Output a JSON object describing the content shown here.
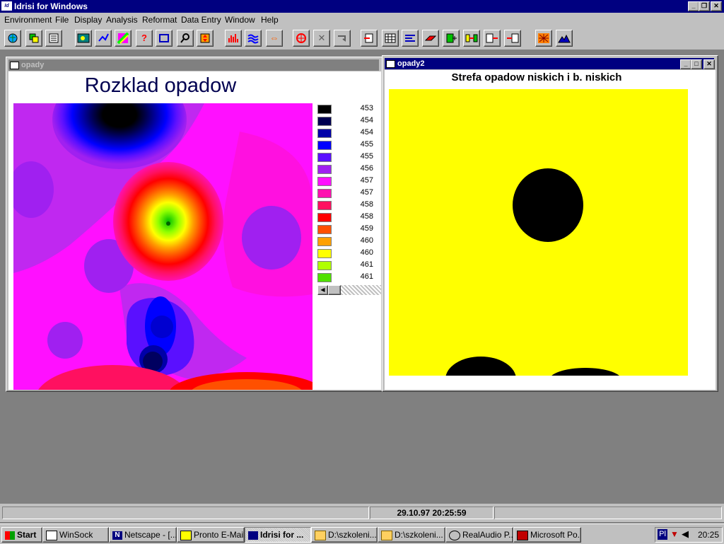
{
  "app": {
    "title": "Idrisi for Windows",
    "logo_text": "Idrisi"
  },
  "menu": [
    "Environment",
    "File",
    "Display",
    "Analysis",
    "Reformat",
    "Data Entry",
    "Window",
    "Help"
  ],
  "window1": {
    "title": "opady",
    "map_title": "Rozklad opadow",
    "legend": [
      {
        "label": "453",
        "color": "#000000"
      },
      {
        "label": "454",
        "color": "#000050"
      },
      {
        "label": "454",
        "color": "#0000a8"
      },
      {
        "label": "455",
        "color": "#0000ff"
      },
      {
        "label": "455",
        "color": "#5a10ff"
      },
      {
        "label": "456",
        "color": "#a020f0"
      },
      {
        "label": "457",
        "color": "#ff10ff"
      },
      {
        "label": "457",
        "color": "#ff10b0"
      },
      {
        "label": "458",
        "color": "#ff1060"
      },
      {
        "label": "458",
        "color": "#ff0000"
      },
      {
        "label": "459",
        "color": "#ff5000"
      },
      {
        "label": "460",
        "color": "#ffa000"
      },
      {
        "label": "460",
        "color": "#ffff00"
      },
      {
        "label": "461",
        "color": "#b0ff00"
      },
      {
        "label": "461",
        "color": "#50e000"
      }
    ]
  },
  "window2": {
    "title": "opady2",
    "map_title": "Strefa opadow niskich i b. niskich"
  },
  "status": {
    "datetime": "29.10.97 20:25:59"
  },
  "taskbar": {
    "start": "Start",
    "items": [
      "WinSock",
      "Netscape - [...",
      "Pronto E-Mail",
      "Idrisi for ...",
      "D:\\szkoleni...",
      "D:\\szkoleni...",
      "RealAudio P...",
      "Microsoft Po..."
    ],
    "tray_lang": "Pl",
    "clock": "20:25"
  },
  "colors": {
    "title_active": "#000080",
    "title_inactive": "#808080",
    "map_yellow": "#ffff00",
    "map_magenta": "#ff10ff"
  }
}
